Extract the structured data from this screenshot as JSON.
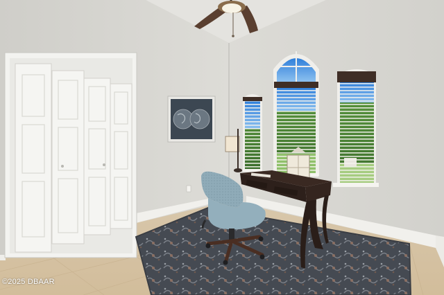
{
  "watermark": {
    "text": "©2025 DBAAR"
  },
  "colors": {
    "wall_left": "#d6d5d0",
    "wall_right": "#dcdbd6",
    "ceiling": "#e6e5e1",
    "floor_tile": "#d9c6a8",
    "baseboard": "#f3f2ee",
    "closet_door": "#f4f4f1",
    "desk_wood": "#3c2a22",
    "chair_fabric": "#8faab6",
    "rug": "#4a4e55",
    "sky": "#3f8fe0",
    "foliage": "#4f8a3a",
    "blind": "#f2f1ec"
  }
}
